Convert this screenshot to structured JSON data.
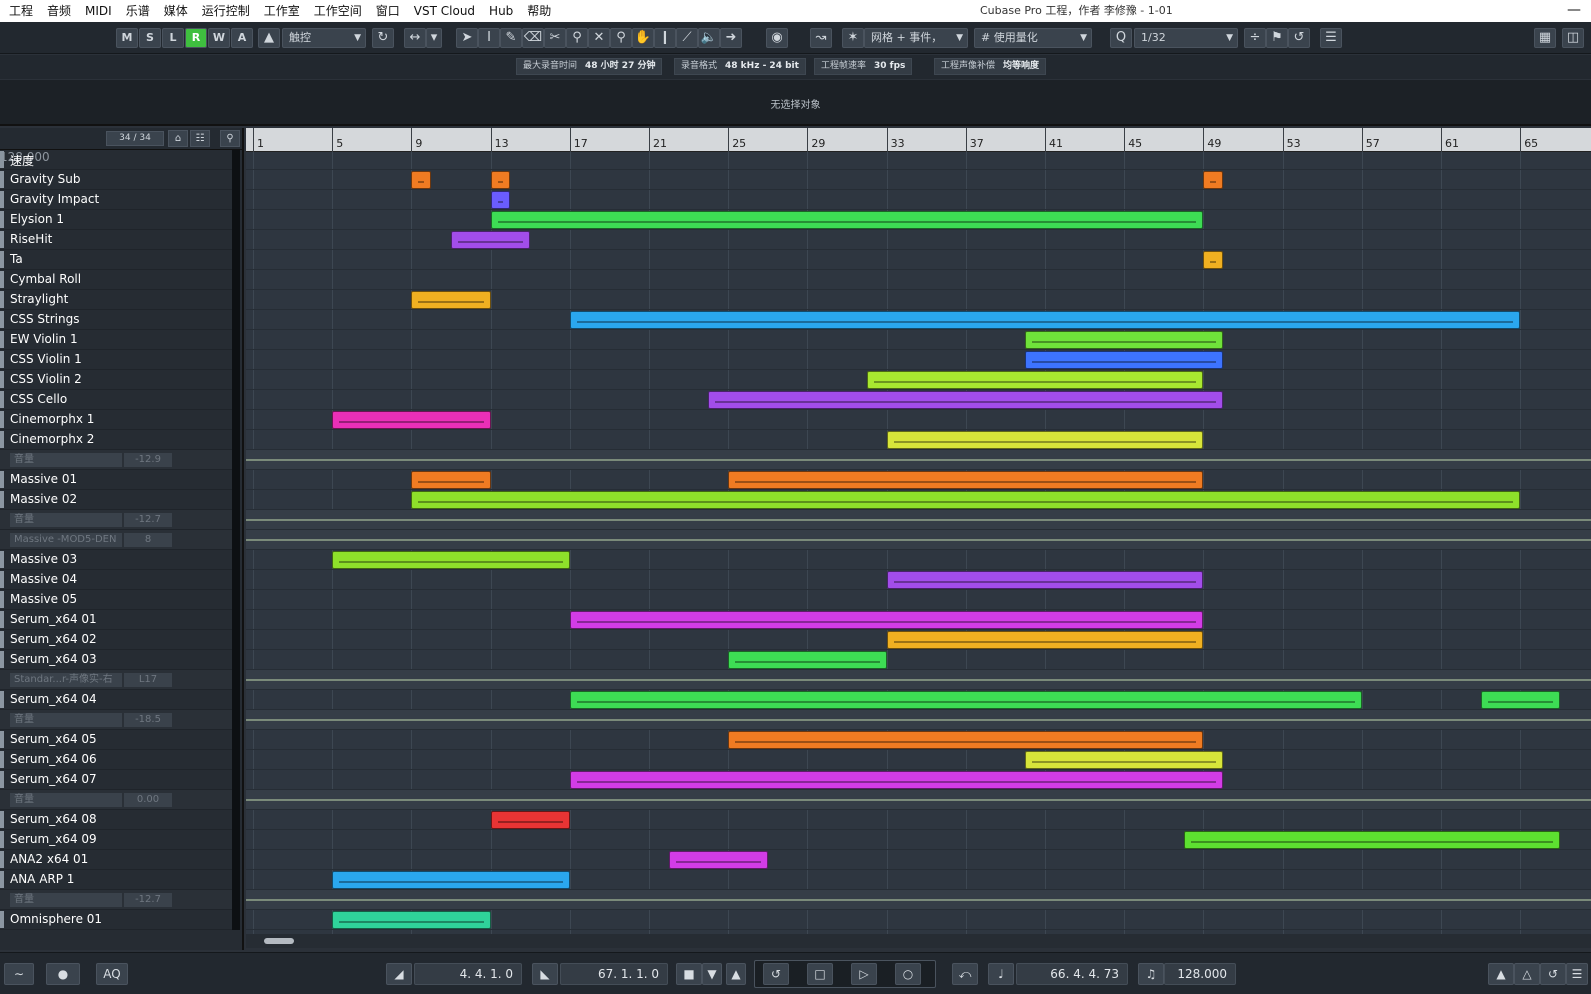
{
  "menubar": {
    "items": [
      "工程",
      "音频",
      "MIDI",
      "乐谱",
      "媒体",
      "运行控制",
      "工作室",
      "工作空间",
      "窗口",
      "VST Cloud",
      "Hub",
      "帮助"
    ],
    "window_title": "Cubase Pro 工程，作者 李修豫 - 1-01",
    "minimize": "—"
  },
  "toolbar": {
    "state_buttons": [
      "M",
      "S",
      "L",
      "R",
      "W",
      "A"
    ],
    "active_state": "R",
    "touch_mode": "触控",
    "snap_type": "网格 + 事件，",
    "quantize_mode": "使用量化",
    "quantize_value": "1/32"
  },
  "infobar": {
    "max_record_label": "最大录音时间",
    "max_record_value": "48 小时 27 分钟",
    "format_label": "录音格式",
    "format_value": "48 kHz - 24 bit",
    "fps_label": "工程帧速率",
    "fps_value": "30 fps",
    "pan_label": "工程声像补偿",
    "pan_value": "均等响度"
  },
  "selection_text": "无选择对象",
  "track_header": {
    "count": "34 / 34"
  },
  "ruler_labels": [
    "1",
    "5",
    "9",
    "13",
    "17",
    "21",
    "25",
    "29",
    "33",
    "37",
    "41",
    "45",
    "49",
    "53",
    "57",
    "61",
    "65"
  ],
  "tracks": [
    {
      "name": "速度",
      "kind": "tempo",
      "value": "128.000"
    },
    {
      "name": "Gravity Sub",
      "kind": "inst",
      "color": "#f07b22"
    },
    {
      "name": "Gravity Impact",
      "kind": "inst",
      "color": "#6a5cff"
    },
    {
      "name": "Elysion 1",
      "kind": "inst",
      "color": "#3ddc54"
    },
    {
      "name": "RiseHit",
      "kind": "inst",
      "color": "#a24dea"
    },
    {
      "name": "Ta",
      "kind": "inst",
      "color": "#f0b021"
    },
    {
      "name": "Cymbal Roll",
      "kind": "inst",
      "color": "#8a95a0"
    },
    {
      "name": "Straylight",
      "kind": "inst",
      "color": "#f0b021"
    },
    {
      "name": "CSS Strings",
      "kind": "inst",
      "color": "#2aa7ee"
    },
    {
      "name": "EW Violin 1",
      "kind": "inst",
      "color": "#6fe23a"
    },
    {
      "name": "CSS Violin 1",
      "kind": "inst",
      "color": "#3d73ff"
    },
    {
      "name": "CSS Violin 2",
      "kind": "inst",
      "color": "#a8e830"
    },
    {
      "name": "CSS Cello",
      "kind": "inst",
      "color": "#a24dea"
    },
    {
      "name": "Cinemorphx 1",
      "kind": "inst",
      "color": "#ea2fb7"
    },
    {
      "name": "Cinemorphx 2",
      "kind": "inst",
      "color": "#d7e53a"
    },
    {
      "name": "音量",
      "kind": "auto",
      "value": "-12.9"
    },
    {
      "name": "Massive 01",
      "kind": "inst",
      "color": "#f07b22"
    },
    {
      "name": "Massive 02",
      "kind": "inst",
      "color": "#8ee02a"
    },
    {
      "name": "音量",
      "kind": "auto",
      "value": "-12.7"
    },
    {
      "name": "Massive -MOD5-DEN",
      "kind": "auto",
      "value": "8"
    },
    {
      "name": "Massive 03",
      "kind": "inst",
      "color": "#8ee02a"
    },
    {
      "name": "Massive 04",
      "kind": "inst",
      "color": "#a24dea"
    },
    {
      "name": "Massive 05",
      "kind": "inst",
      "color": "#8a95a0"
    },
    {
      "name": "Serum_x64 01",
      "kind": "inst",
      "color": "#d23ce6"
    },
    {
      "name": "Serum_x64 02",
      "kind": "inst",
      "color": "#f0b021"
    },
    {
      "name": "Serum_x64 03",
      "kind": "inst",
      "color": "#3ddc54"
    },
    {
      "name": "Standar...r-声像实-右",
      "kind": "auto",
      "value": "L17"
    },
    {
      "name": "Serum_x64 04",
      "kind": "inst",
      "color": "#3ddc54"
    },
    {
      "name": "音量",
      "kind": "auto",
      "value": "-18.5"
    },
    {
      "name": "Serum_x64 05",
      "kind": "inst",
      "color": "#f07b22"
    },
    {
      "name": "Serum_x64 06",
      "kind": "inst",
      "color": "#d7e53a"
    },
    {
      "name": "Serum_x64 07",
      "kind": "inst",
      "color": "#d23ce6"
    },
    {
      "name": "音量",
      "kind": "auto",
      "value": "0.00"
    },
    {
      "name": "Serum_x64 08",
      "kind": "inst",
      "color": "#e83434"
    },
    {
      "name": "Serum_x64 09",
      "kind": "inst",
      "color": "#5de030"
    },
    {
      "name": "ANA2 x64 01",
      "kind": "inst",
      "color": "#d23ce6"
    },
    {
      "name": "ANA ARP 1",
      "kind": "inst",
      "color": "#2aa7ee"
    },
    {
      "name": "音量",
      "kind": "auto",
      "value": "-12.7"
    },
    {
      "name": "Omnisphere 01",
      "kind": "inst",
      "color": "#2fd39a"
    }
  ],
  "events": [
    {
      "row": 1,
      "start": 9,
      "end": 10,
      "color": "#f07b22"
    },
    {
      "row": 1,
      "start": 13,
      "end": 14,
      "color": "#f07b22"
    },
    {
      "row": 1,
      "start": 49,
      "end": 50,
      "color": "#f07b22"
    },
    {
      "row": 2,
      "start": 13,
      "end": 14,
      "color": "#6a5cff"
    },
    {
      "row": 3,
      "start": 13,
      "end": 49,
      "color": "#3ddc54"
    },
    {
      "row": 4,
      "start": 11,
      "end": 15,
      "color": "#a24dea"
    },
    {
      "row": 5,
      "start": 49,
      "end": 50,
      "color": "#f0b021"
    },
    {
      "row": 7,
      "start": 9,
      "end": 13,
      "color": "#f0b021"
    },
    {
      "row": 8,
      "start": 17,
      "end": 65,
      "color": "#2aa7ee"
    },
    {
      "row": 9,
      "start": 40,
      "end": 50,
      "color": "#6fe23a"
    },
    {
      "row": 10,
      "start": 40,
      "end": 50,
      "color": "#3d73ff"
    },
    {
      "row": 11,
      "start": 32,
      "end": 49,
      "color": "#a8e830"
    },
    {
      "row": 12,
      "start": 24,
      "end": 50,
      "color": "#a24dea"
    },
    {
      "row": 13,
      "start": 5,
      "end": 13,
      "color": "#ea2fb7"
    },
    {
      "row": 14,
      "start": 33,
      "end": 49,
      "color": "#d7e53a"
    },
    {
      "row": 16,
      "start": 9,
      "end": 13,
      "color": "#f07b22"
    },
    {
      "row": 16,
      "start": 25,
      "end": 49,
      "color": "#f07b22"
    },
    {
      "row": 17,
      "start": 9,
      "end": 65,
      "color": "#8ee02a"
    },
    {
      "row": 20,
      "start": 5,
      "end": 17,
      "color": "#8ee02a"
    },
    {
      "row": 21,
      "start": 33,
      "end": 49,
      "color": "#a24dea"
    },
    {
      "row": 23,
      "start": 17,
      "end": 49,
      "color": "#d23ce6"
    },
    {
      "row": 24,
      "start": 33,
      "end": 49,
      "color": "#f0b021"
    },
    {
      "row": 25,
      "start": 25,
      "end": 33,
      "color": "#3ddc54"
    },
    {
      "row": 27,
      "start": 17,
      "end": 57,
      "color": "#3ddc54"
    },
    {
      "row": 27,
      "start": 63,
      "end": 67,
      "color": "#3ddc54"
    },
    {
      "row": 29,
      "start": 25,
      "end": 49,
      "color": "#f07b22"
    },
    {
      "row": 30,
      "start": 40,
      "end": 50,
      "color": "#d7e53a"
    },
    {
      "row": 31,
      "start": 17,
      "end": 50,
      "color": "#d23ce6"
    },
    {
      "row": 33,
      "start": 13,
      "end": 17,
      "color": "#e83434"
    },
    {
      "row": 34,
      "start": 48,
      "end": 67,
      "color": "#5de030"
    },
    {
      "row": 35,
      "start": 22,
      "end": 27,
      "color": "#d23ce6"
    },
    {
      "row": 36,
      "start": 5,
      "end": 17,
      "color": "#2aa7ee"
    },
    {
      "row": 38,
      "start": 5,
      "end": 13,
      "color": "#2fd39a"
    }
  ],
  "transport": {
    "left_locator": "4. 4. 1.  0",
    "right_locator": "67. 1. 1.  0",
    "position": "66. 4. 4. 73",
    "tempo": "128.000",
    "aq_label": "AQ"
  }
}
